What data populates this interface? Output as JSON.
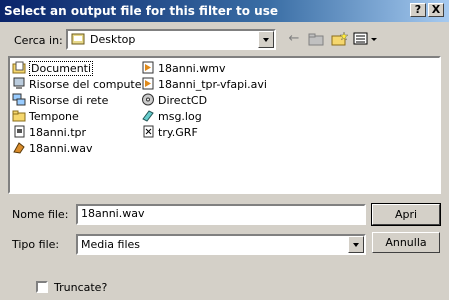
{
  "window": {
    "title": "Select an output file for this filter to use",
    "help_label": "?",
    "close_label": "X"
  },
  "lookin": {
    "label": "Cerca in:",
    "value": "Desktop"
  },
  "files": [
    {
      "name": "Documenti",
      "icon": "folder-documents-icon"
    },
    {
      "name": "Risorse del computer",
      "icon": "computer-icon"
    },
    {
      "name": "Risorse di rete",
      "icon": "network-icon"
    },
    {
      "name": "Tempone",
      "icon": "folder-icon"
    },
    {
      "name": "18anni.tpr",
      "icon": "file-icon"
    },
    {
      "name": "18anni.wav",
      "icon": "audio-file-icon"
    },
    {
      "name": "18anni.wmv",
      "icon": "media-file-icon"
    },
    {
      "name": "18anni_tpr-vfapi.avi",
      "icon": "media-file-icon"
    },
    {
      "name": "DirectCD",
      "icon": "cd-icon"
    },
    {
      "name": "msg.log",
      "icon": "log-file-icon"
    },
    {
      "name": "try.GRF",
      "icon": "graph-file-icon"
    }
  ],
  "filename": {
    "label": "Nome file:",
    "value": "18anni.wav"
  },
  "filetype": {
    "label": "Tipo file:",
    "value": "Media files"
  },
  "buttons": {
    "open": "Apri",
    "cancel": "Annulla"
  },
  "truncate": {
    "label": "Truncate?"
  }
}
